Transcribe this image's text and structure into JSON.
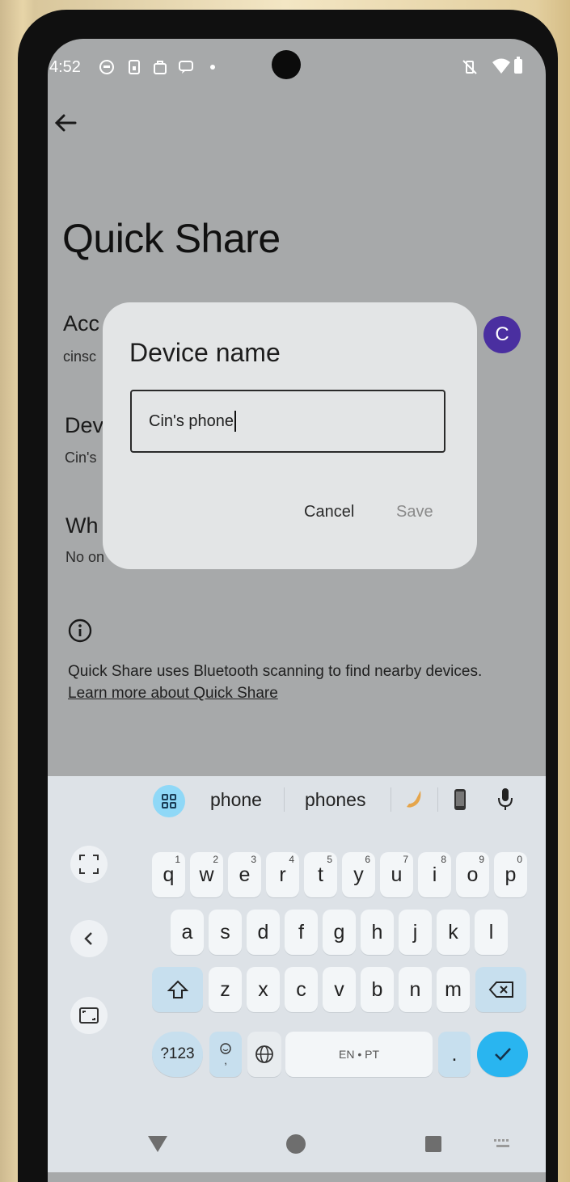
{
  "status_bar": {
    "time": "4:52"
  },
  "screen": {
    "title": "Quick Share",
    "account": {
      "title": "Acc",
      "subtitle": "cinsc",
      "avatar_letter": "C"
    },
    "device": {
      "title": "Dev",
      "subtitle": "Cin's"
    },
    "who": {
      "title": "Wh",
      "subtitle": "No on"
    },
    "info_text": "Quick Share uses Bluetooth scanning to find nearby devices.",
    "info_link": "Learn more about Quick Share"
  },
  "dialog": {
    "title": "Device name",
    "value": "Cin's phone",
    "cancel_label": "Cancel",
    "save_label": "Save"
  },
  "keyboard": {
    "suggestions": [
      "phone",
      "phones"
    ],
    "row1": [
      {
        "k": "q",
        "n": "1"
      },
      {
        "k": "w",
        "n": "2"
      },
      {
        "k": "e",
        "n": "3"
      },
      {
        "k": "r",
        "n": "4"
      },
      {
        "k": "t",
        "n": "5"
      },
      {
        "k": "y",
        "n": "6"
      },
      {
        "k": "u",
        "n": "7"
      },
      {
        "k": "i",
        "n": "8"
      },
      {
        "k": "o",
        "n": "9"
      },
      {
        "k": "p",
        "n": "0"
      }
    ],
    "row2": [
      "a",
      "s",
      "d",
      "f",
      "g",
      "h",
      "j",
      "k",
      "l"
    ],
    "row3": [
      "z",
      "x",
      "c",
      "v",
      "b",
      "n",
      "m"
    ],
    "symbols_label": "?123",
    "space_label": "EN • PT",
    "period_label": "."
  },
  "colors": {
    "accent": "#29b5f0",
    "avatar": "#4a2fa0",
    "dialog": "#e3e5e6"
  }
}
